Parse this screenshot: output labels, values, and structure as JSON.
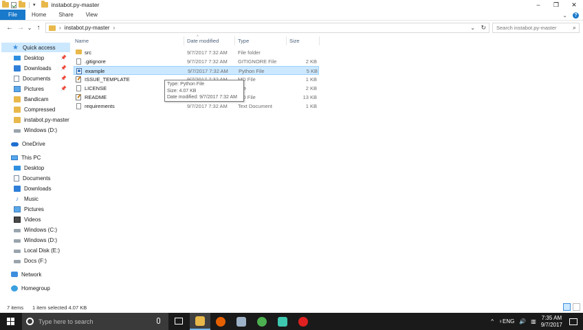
{
  "window": {
    "title": "instabot.py-master",
    "controls": {
      "minimize": "–",
      "maximize": "❐",
      "close": "✕"
    }
  },
  "ribbon": {
    "tabs": [
      "File",
      "Home",
      "Share",
      "View"
    ],
    "expand_icon": "chevron-down-icon",
    "help_icon": "help-icon"
  },
  "address": {
    "back": "←",
    "forward": "→",
    "recent": "⌄",
    "up": "↑",
    "path_separator": "›",
    "path": "instabot.py-master",
    "path_end_separator": "›",
    "dropdown": "⌄",
    "refresh": "↻"
  },
  "search": {
    "placeholder": "Search instabot.py-master",
    "icon": "⌕"
  },
  "sidebar": {
    "quick_access": "Quick access",
    "quick_items": [
      {
        "label": "Desktop",
        "icon": "desktop-icon",
        "pinned": true
      },
      {
        "label": "Downloads",
        "icon": "downloads-icon",
        "pinned": true
      },
      {
        "label": "Documents",
        "icon": "documents-icon",
        "pinned": true
      },
      {
        "label": "Pictures",
        "icon": "pictures-icon",
        "pinned": true
      },
      {
        "label": "Bandicam",
        "icon": "folder-icon",
        "pinned": false
      },
      {
        "label": "Compressed",
        "icon": "folder-icon",
        "pinned": false
      },
      {
        "label": "instabot.py-master",
        "icon": "folder-icon",
        "pinned": false
      },
      {
        "label": "Windows (D:)",
        "icon": "drive-icon",
        "pinned": false
      }
    ],
    "onedrive": "OneDrive",
    "this_pc": "This PC",
    "pc_items": [
      {
        "label": "Desktop",
        "icon": "desktop-icon"
      },
      {
        "label": "Documents",
        "icon": "documents-icon"
      },
      {
        "label": "Downloads",
        "icon": "downloads-icon"
      },
      {
        "label": "Music",
        "icon": "music-icon"
      },
      {
        "label": "Pictures",
        "icon": "pictures-icon"
      },
      {
        "label": "Videos",
        "icon": "videos-icon"
      },
      {
        "label": "Windows (C:)",
        "icon": "drive-icon"
      },
      {
        "label": "Windows (D:)",
        "icon": "drive-icon"
      },
      {
        "label": "Local Disk (E:)",
        "icon": "drive-icon"
      },
      {
        "label": "Docs (F:)",
        "icon": "drive-icon"
      }
    ],
    "network": "Network",
    "homegroup": "Homegroup",
    "pin_glyph": "📌"
  },
  "columns": {
    "name": "Name",
    "date": "Date modified",
    "type": "Type",
    "size": "Size",
    "sort_glyph": "^"
  },
  "files": [
    {
      "name": "src",
      "date": "9/7/2017 7:32 AM",
      "type": "File folder",
      "size": "",
      "icon": "folder-icon",
      "selected": false
    },
    {
      "name": ".gitignore",
      "date": "9/7/2017 7:32 AM",
      "type": "GITIGNORE File",
      "size": "2 KB",
      "icon": "file-icon",
      "selected": false
    },
    {
      "name": "example",
      "date": "9/7/2017 7:32 AM",
      "type": "Python File",
      "size": "5 KB",
      "icon": "python-file-icon",
      "selected": true
    },
    {
      "name": "ISSUE_TEMPLATE",
      "date": "9/7/2017 7:32 AM",
      "type": "MD File",
      "size": "1 KB",
      "icon": "md-file-icon",
      "selected": false
    },
    {
      "name": "LICENSE",
      "date": "9/7/2017 7:32 AM",
      "type": "File",
      "size": "2 KB",
      "icon": "file-icon",
      "selected": false
    },
    {
      "name": "README",
      "date": "9/7/2017 7:32 AM",
      "type": "MD File",
      "size": "13 KB",
      "icon": "md-file-icon",
      "selected": false
    },
    {
      "name": "requirements",
      "date": "9/7/2017 7:32 AM",
      "type": "Text Document",
      "size": "1 KB",
      "icon": "file-icon",
      "selected": false
    }
  ],
  "tooltip": {
    "type": "Type: Python File",
    "size": "Size: 4.07 KB",
    "modified": "Date modified: 9/7/2017 7:32 AM"
  },
  "status": {
    "count": "7 items",
    "selection": "1 item selected  4.07 KB"
  },
  "taskbar": {
    "search_placeholder": "Type here to search",
    "apps": [
      {
        "name": "file-explorer",
        "color": "#e8b84a",
        "active": true
      },
      {
        "name": "firefox",
        "color": "#e66000",
        "active": false
      },
      {
        "name": "pc-app",
        "color": "#9fb3c8",
        "active": false
      },
      {
        "name": "chrome",
        "color": "#4caf50",
        "active": false
      },
      {
        "name": "plant-app",
        "color": "#3ec8b0",
        "active": false
      },
      {
        "name": "recorder",
        "color": "#e02020",
        "active": false
      }
    ],
    "tray": {
      "chevron": "^",
      "keyboard": "♀ENG",
      "volume": "🔊",
      "network": "▥",
      "lang": "ENG"
    },
    "time": "7:35 AM",
    "date": "9/7/2017"
  }
}
